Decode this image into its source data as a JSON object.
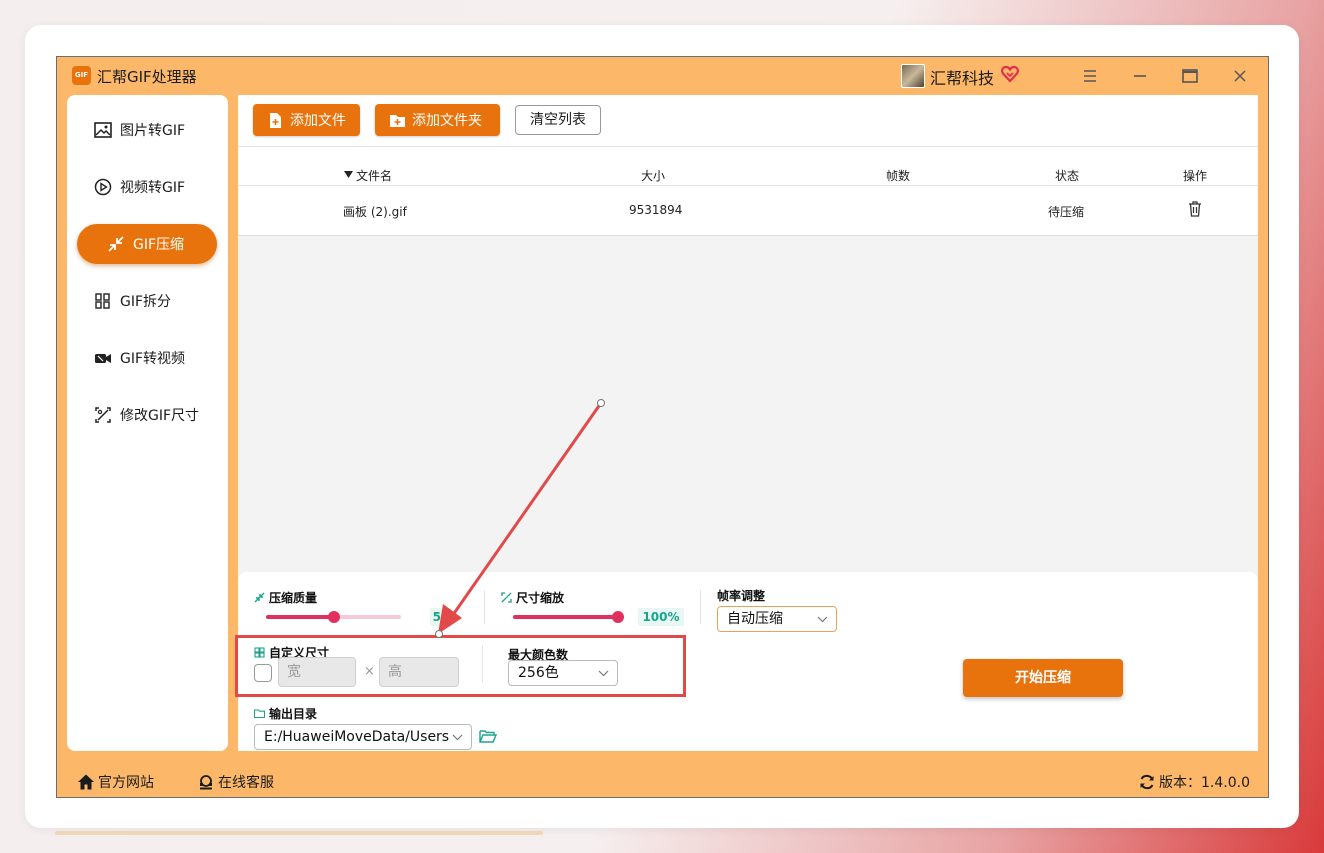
{
  "app": {
    "title": "汇帮GIF处理器",
    "logo_text": "GIF",
    "brand": "汇帮科技",
    "accent": "#e8720c",
    "frame_bg": "#fcb868"
  },
  "sidebar": {
    "items": [
      {
        "label": "图片转GIF",
        "icon": "image-icon"
      },
      {
        "label": "视频转GIF",
        "icon": "play-icon"
      },
      {
        "label": "GIF压缩",
        "icon": "compress-icon",
        "active": true
      },
      {
        "label": "GIF拆分",
        "icon": "split-icon"
      },
      {
        "label": "GIF转视频",
        "icon": "video-icon"
      },
      {
        "label": "修改GIF尺寸",
        "icon": "resize-icon"
      }
    ]
  },
  "toolbar": {
    "add_file": "添加文件",
    "add_folder": "添加文件夹",
    "clear_list": "清空列表"
  },
  "table": {
    "columns": [
      "文件名",
      "大小",
      "帧数",
      "状态",
      "操作"
    ],
    "rows": [
      {
        "name": "画板 (2).gif",
        "size": "9531894",
        "frames": "",
        "status": "待压缩"
      }
    ]
  },
  "settings": {
    "quality": {
      "label": "压缩质量",
      "value": "50",
      "fraction": 0.5
    },
    "scale": {
      "label": "尺寸缩放",
      "value": "100%",
      "fraction": 1.0
    },
    "framerate": {
      "label": "帧率调整",
      "selected": "自动压缩"
    },
    "custom_size": {
      "label": "自定义尺寸",
      "width_placeholder": "宽",
      "height_placeholder": "高",
      "times": "×"
    },
    "max_colors": {
      "label": "最大颜色数",
      "selected": "256色"
    },
    "output": {
      "label": "输出目录",
      "path": "E:/HuaweiMoveData/Users"
    },
    "start": "开始压缩"
  },
  "status": {
    "website": "官方网站",
    "support": "在线客服",
    "version": "版本：1.4.0.0"
  },
  "annotation": {
    "color": "#e24a4a"
  }
}
